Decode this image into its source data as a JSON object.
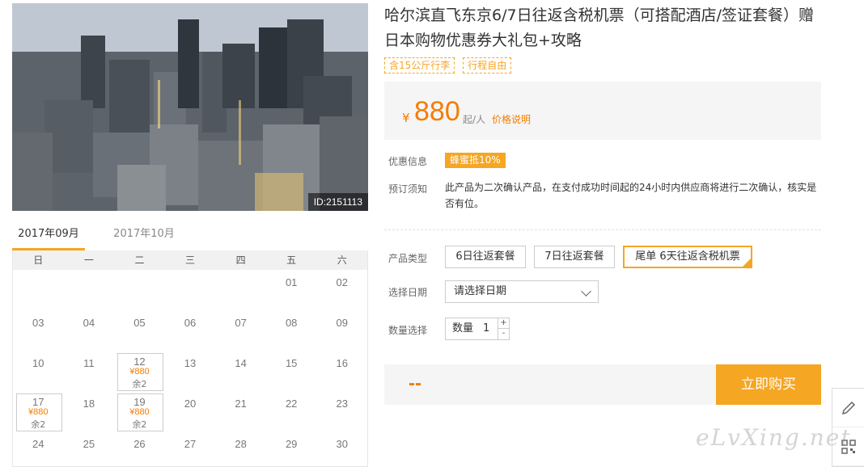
{
  "hero": {
    "image_id": "ID:2151113"
  },
  "calendar": {
    "tabs": [
      "2017年09月",
      "2017年10月"
    ],
    "weekdays": [
      "日",
      "一",
      "二",
      "三",
      "四",
      "五",
      "六"
    ],
    "rows": [
      [
        {
          "d": ""
        },
        {
          "d": ""
        },
        {
          "d": ""
        },
        {
          "d": ""
        },
        {
          "d": ""
        },
        {
          "d": "01"
        },
        {
          "d": "02"
        }
      ],
      [
        {
          "d": "03"
        },
        {
          "d": "04"
        },
        {
          "d": "05"
        },
        {
          "d": "06"
        },
        {
          "d": "07"
        },
        {
          "d": "08"
        },
        {
          "d": "09"
        }
      ],
      [
        {
          "d": "10"
        },
        {
          "d": "11"
        },
        {
          "d": "12",
          "price": "¥880",
          "remain": "余2"
        },
        {
          "d": "13"
        },
        {
          "d": "14"
        },
        {
          "d": "15"
        },
        {
          "d": "16"
        }
      ],
      [
        {
          "d": "17",
          "price": "¥880",
          "remain": "余2"
        },
        {
          "d": "18"
        },
        {
          "d": "19",
          "price": "¥880",
          "remain": "余2"
        },
        {
          "d": "20"
        },
        {
          "d": "21"
        },
        {
          "d": "22"
        },
        {
          "d": "23"
        }
      ],
      [
        {
          "d": "24"
        },
        {
          "d": "25"
        },
        {
          "d": "26"
        },
        {
          "d": "27"
        },
        {
          "d": "28"
        },
        {
          "d": "29"
        },
        {
          "d": "30"
        }
      ]
    ]
  },
  "product": {
    "title": "哈尔滨直飞东京6/7日往返含税机票（可搭配酒店/签证套餐）赠日本购物优惠券大礼包+攻略",
    "tags": [
      "含15公斤行李",
      "行程自由"
    ],
    "price": {
      "currency": "¥",
      "amount": "880",
      "unit": "起/人",
      "note": "价格说明"
    },
    "discount_label": "优惠信息",
    "discount_value": "蜂蜜抵10%",
    "notice_label": "预订须知",
    "notice_text": "此产品为二次确认产品，在支付成功时间起的24小时内供应商将进行二次确认，核实是否有位。",
    "type_label": "产品类型",
    "options": [
      "6日往返套餐",
      "7日往返套餐",
      "尾单 6天往返含税机票"
    ],
    "date_label": "选择日期",
    "date_placeholder": "请选择日期",
    "qty_label": "数量选择",
    "qty_inner_label": "数量",
    "qty_value": "1",
    "qty_plus": "+",
    "qty_minus": "-",
    "total": "--",
    "buy_label": "立即购买"
  },
  "watermark": "eLvXing.net",
  "colors": {
    "accent": "#f5a623",
    "price": "#f57c00"
  }
}
